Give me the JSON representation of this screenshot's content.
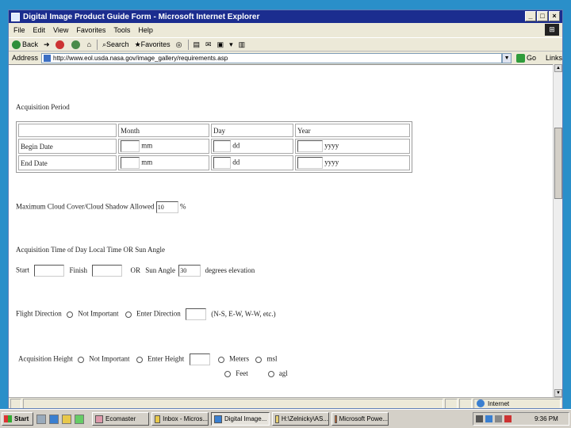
{
  "window": {
    "title": "Digital Image Product Guide Form - Microsoft Internet Explorer"
  },
  "menubar": [
    "File",
    "Edit",
    "View",
    "Favorites",
    "Tools",
    "Help"
  ],
  "toolbar": {
    "back": "Back",
    "search": "Search",
    "favorites": "Favorites"
  },
  "address": {
    "label": "Address",
    "url": "http://www.eol.usda.nasa.gov/image_gallery/requirements.asp",
    "go": "Go",
    "links": "Links"
  },
  "form": {
    "acq_period_label": "Acquisition Period",
    "table": {
      "headers": [
        "Month",
        "Day",
        "Year"
      ],
      "rows": [
        {
          "label": "Begin Date",
          "month_ph": "mm",
          "day_ph": "dd",
          "year_ph": "yyyy"
        },
        {
          "label": "End Date",
          "month_ph": "mm",
          "day_ph": "dd",
          "year_ph": "yyyy"
        }
      ]
    },
    "cloud_label": "Maximum Cloud Cover/Cloud Shadow Allowed",
    "cloud_value": "10",
    "cloud_unit": "%",
    "time_label": "Acquisition Time of Day Local Time OR Sun Angle",
    "start_label": "Start",
    "finish_label": "Finish",
    "or_label": "OR",
    "sun_angle_label": "Sun Angle",
    "sun_angle_value": "30",
    "sun_angle_unit": "degrees elevation",
    "flight_dir_label": "Flight Direction",
    "not_important": "Not Important",
    "enter_direction": "Enter Direction",
    "direction_hint": "(N-S, E-W, W-W, etc.)",
    "acq_height_label": "Acquisition Height",
    "enter_height": "Enter Height",
    "meters": "Meters",
    "feet": "Feet",
    "msl": "msl",
    "agl": "agl"
  },
  "status": {
    "zone": "Internet"
  },
  "taskbar": {
    "start": "Start",
    "tasks": [
      "Ecomaster",
      "Inbox - Micros...",
      "Digital Image...",
      "H:\\Zelnicky\\AS...",
      "Microsoft Powe..."
    ],
    "active_index": 2,
    "clock": "9:36 PM"
  }
}
